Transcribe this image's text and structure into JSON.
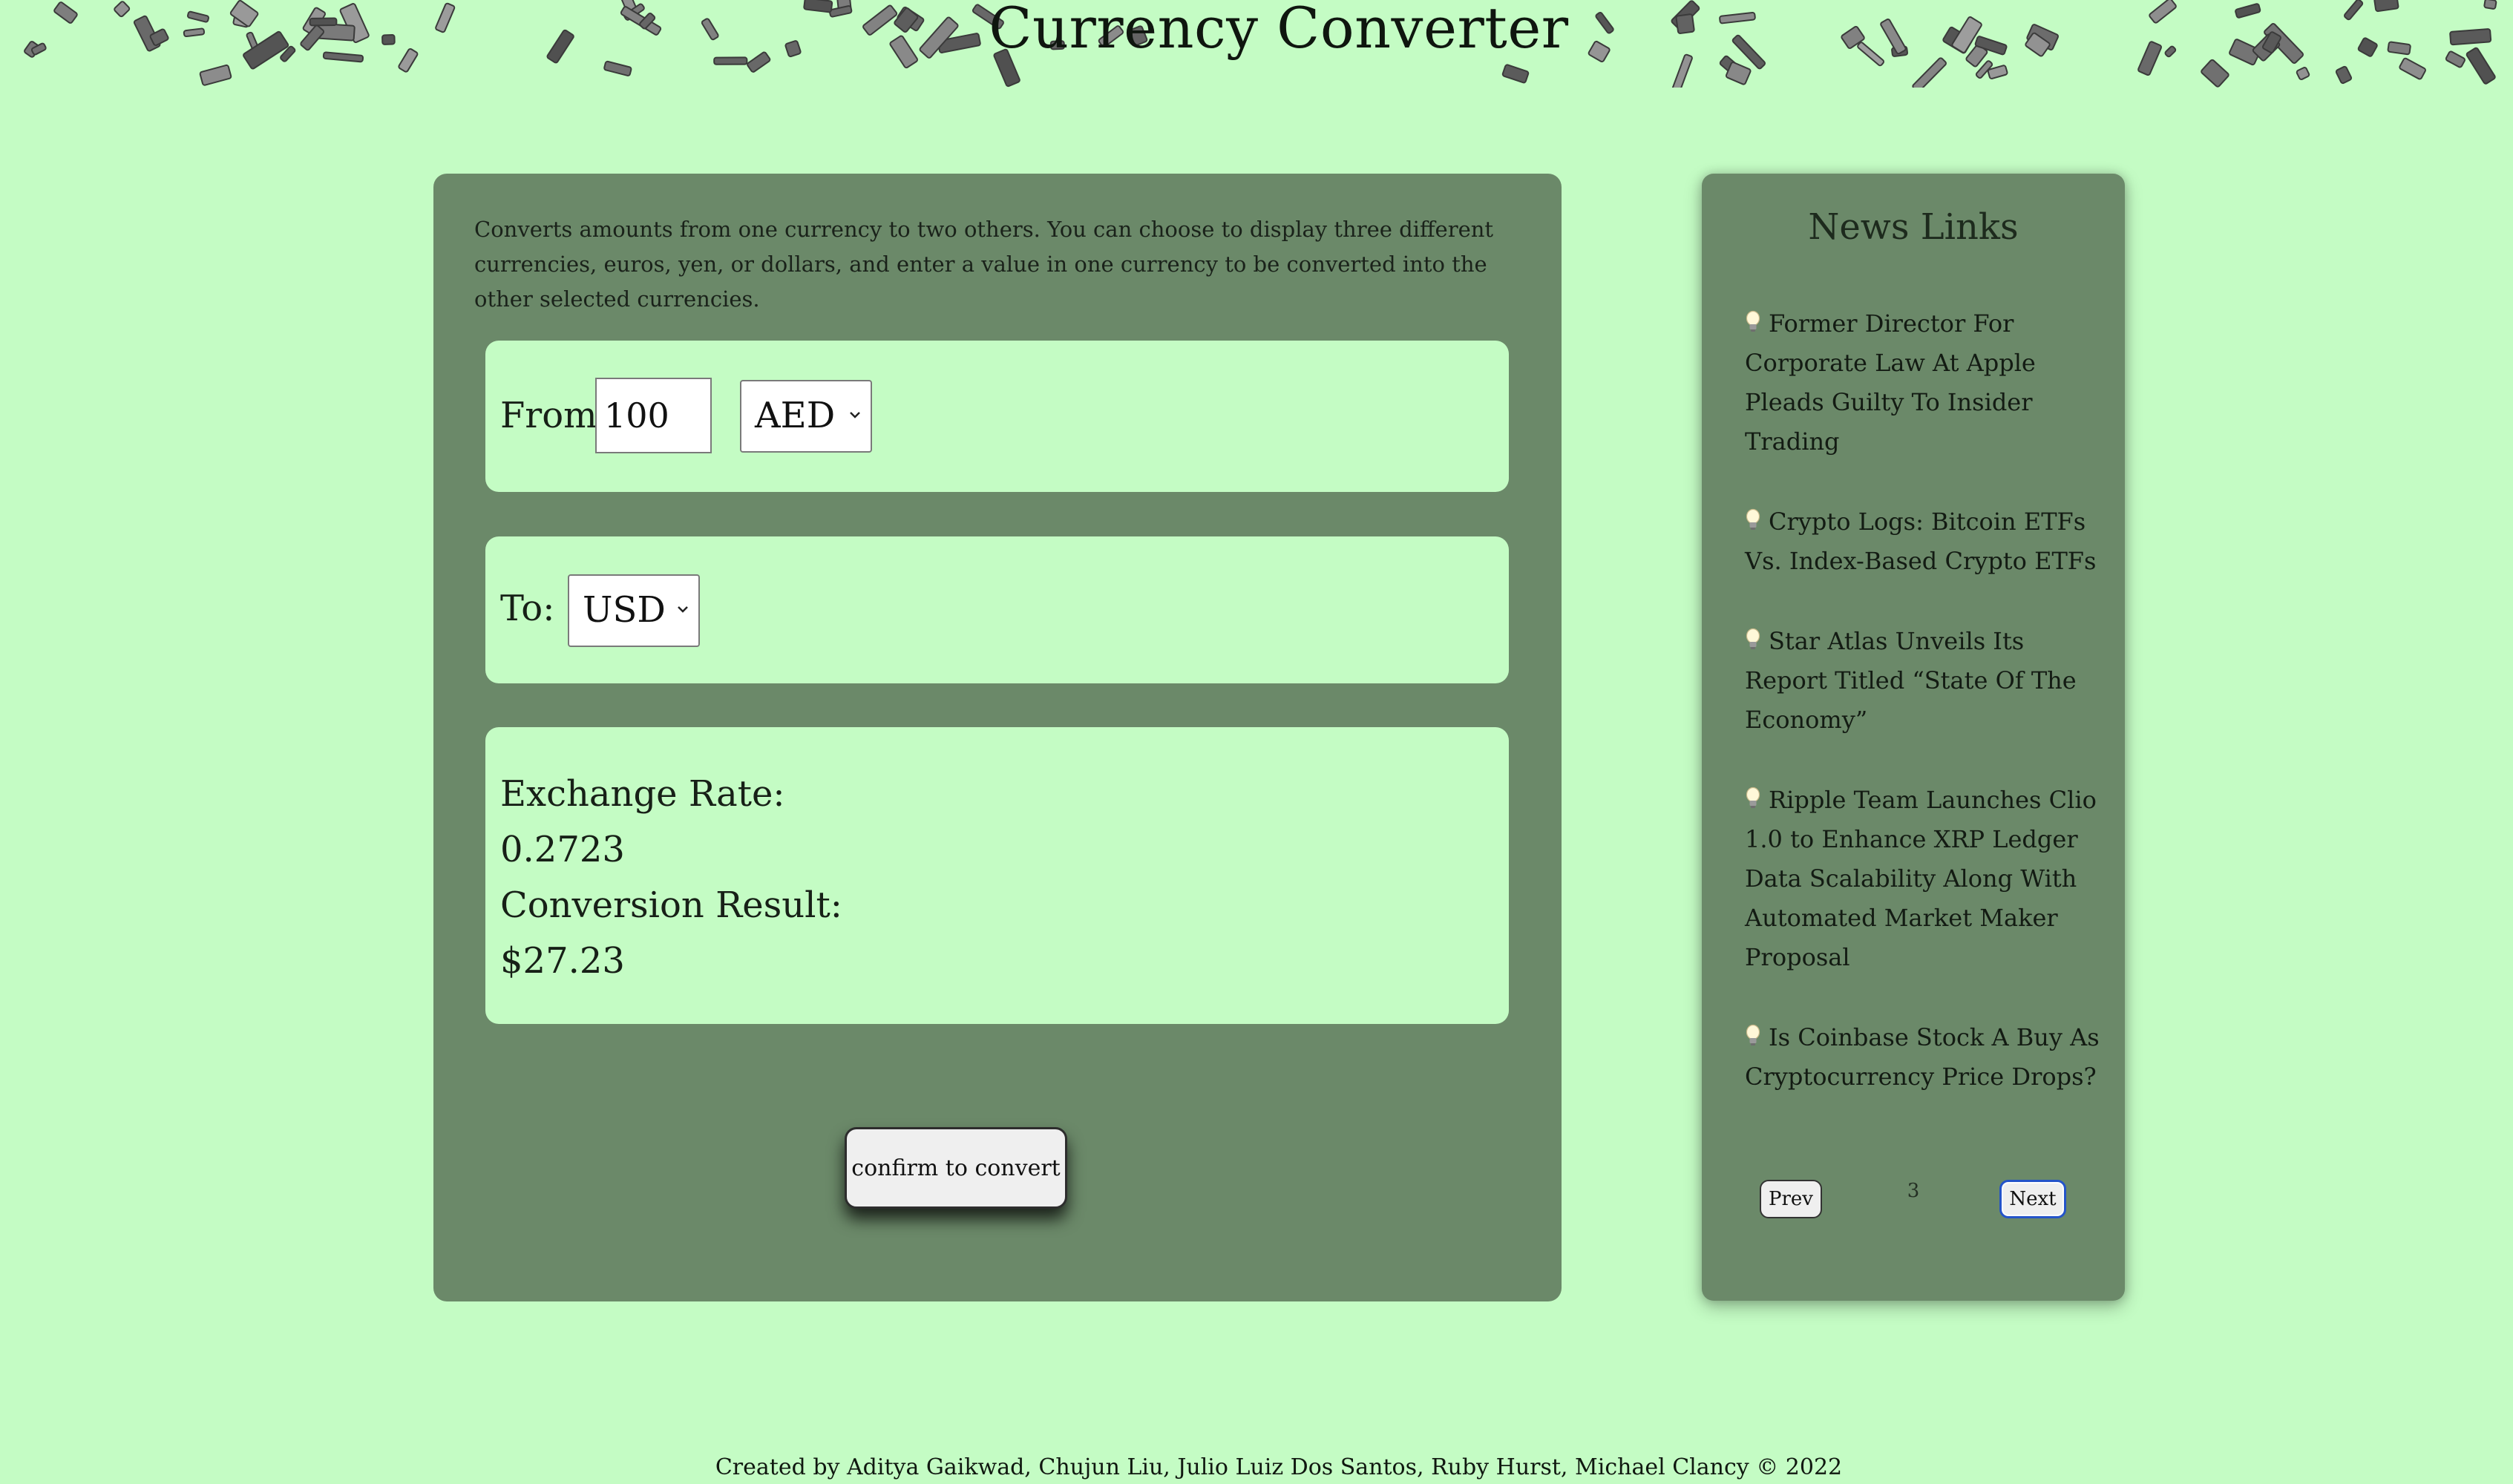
{
  "header": {
    "title": "Currency Converter"
  },
  "converter": {
    "description": "Converts amounts from one currency to two others. You can choose to display three different currencies, euros, yen, or dollars, and enter a value in one currency to be converted into the other selected currencies.",
    "from_label": "From:",
    "amount_value": "100",
    "from_currency": "AED",
    "to_label": "To:",
    "to_currency": "USD",
    "exchange_rate_label": "Exchange Rate:",
    "exchange_rate_value": "0.2723",
    "conversion_result_label": "Conversion Result:",
    "conversion_result_value": "$27.23",
    "convert_button_label": "confirm to convert"
  },
  "news": {
    "title": "News Links",
    "items": [
      {
        "text": "Former Director For Corporate Law At Apple Pleads Guilty To Insider Trading",
        "icon": "lightbulb-icon"
      },
      {
        "text": "Crypto Logs: Bitcoin ETFs Vs. Index-Based Crypto ETFs",
        "icon": "lightbulb-icon"
      },
      {
        "text": "Star Atlas Unveils Its Report Titled “State Of The Economy”",
        "icon": "lightbulb-icon"
      },
      {
        "text": "Ripple Team Launches Clio 1.0 to Enhance XRP Ledger Data Scalability Along With Automated Market Maker Proposal",
        "icon": "lightbulb-icon"
      },
      {
        "text": "Is Coinbase Stock A Buy As Cryptocurrency Price Drops?",
        "icon": "lightbulb-icon"
      }
    ],
    "prev_label": "Prev",
    "page_number": "3",
    "next_label": "Next"
  },
  "footer": {
    "credit": "Created by Aditya Gaikwad, Chujun Liu, Julio Luiz Dos Santos, Ruby Hurst, Michael Clancy © 2022"
  },
  "colors": {
    "page_background": "#c4fcc4",
    "panel_background": "#6b8969",
    "card_background": "#c4fcc4",
    "next_button_focus_ring": "#2454c9"
  }
}
